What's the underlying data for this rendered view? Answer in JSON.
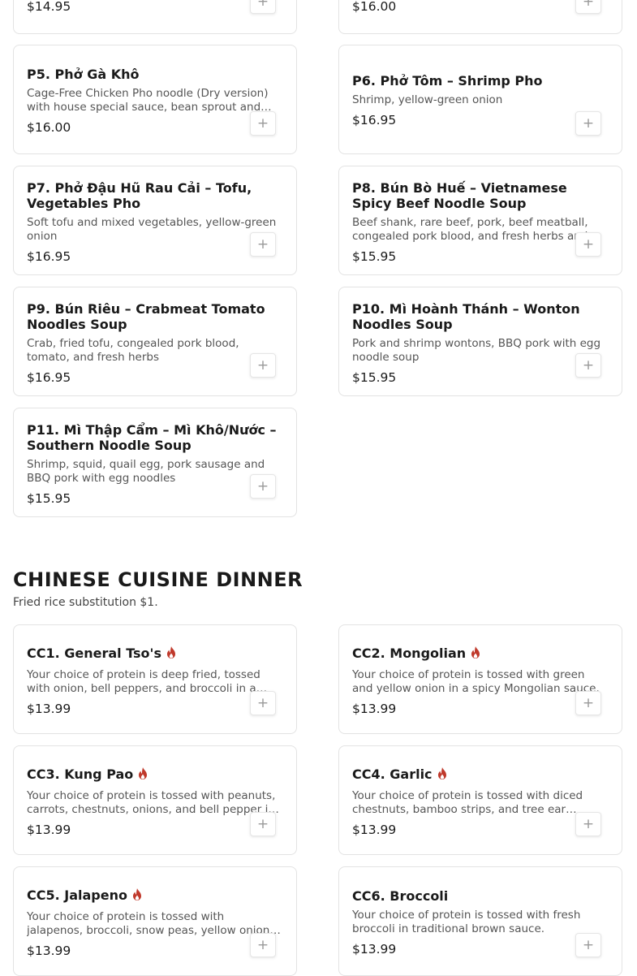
{
  "partial_items": [
    {
      "price": "$14.95"
    },
    {
      "price": "$16.00"
    }
  ],
  "pho_items": [
    {
      "title": "P5. Phở Gà Khô",
      "description": "Cage-Free Chicken Pho noodle (Dry version) with house special sauce, bean sprout and fresh herbs",
      "price": "$16.00"
    },
    {
      "title": "P6. Phở Tôm – Shrimp Pho",
      "description": "Shrimp, yellow-green onion",
      "price": "$16.95"
    },
    {
      "title": "P7. Phở Đậu Hũ Rau Cải – Tofu, Vegetables Pho",
      "description": "Soft tofu and mixed vegetables, yellow-green onion",
      "price": "$16.95"
    },
    {
      "title": "P8. Bún Bò Huế – Vietnamese Spicy Beef Noodle Soup",
      "description": "Beef shank, rare beef, pork, beef meatball, congealed pork blood, and fresh herbs and vegetables",
      "price": "$15.95"
    },
    {
      "title": "P9. Bún Riêu – Crabmeat Tomato Noodles Soup",
      "description": "Crab, fried tofu, congealed pork blood, tomato, and fresh herbs",
      "price": "$16.95"
    },
    {
      "title": "P10. Mì Hoành Thánh – Wonton Noodles Soup",
      "description": "Pork and shrimp wontons, BBQ pork with egg noodle soup",
      "price": "$15.95"
    },
    {
      "title": "P11. Mì Thập Cẩm – Mì Khô/Nước – Southern Noodle Soup",
      "description": "Shrimp, squid, quail egg, pork sausage and BBQ pork with egg noodles",
      "price": "$15.95"
    }
  ],
  "chinese_section": {
    "title": "CHINESE CUISINE DINNER",
    "subtitle": "Fried rice substitution $1."
  },
  "chinese_items": [
    {
      "title": "CC1. General Tso's",
      "description": "Your choice of protein is deep fried, tossed with onion, bell peppers, and broccoli in a sweet and spicy sauce.",
      "price": "$13.99",
      "spicy": true
    },
    {
      "title": "CC2. Mongolian",
      "description": "Your choice of protein is tossed with green and yellow onion in a spicy Mongolian sauce.",
      "price": "$13.99",
      "spicy": true
    },
    {
      "title": "CC3. Kung Pao",
      "description": "Your choice of protein is tossed with peanuts, carrots, chestnuts, onions, and bell pepper in a spicy sauce.",
      "price": "$13.99",
      "spicy": true
    },
    {
      "title": "CC4. Garlic",
      "description": "Your choice of protein is tossed with diced chestnuts, bamboo strips, and tree ear mushrooms in a garlic sauce.",
      "price": "$13.99",
      "spicy": true
    },
    {
      "title": "CC5. Jalapeno",
      "description": "Your choice of protein is tossed with jalapenos, broccoli, snow peas, yellow onions and bell peppers.",
      "price": "$13.99",
      "spicy": true
    },
    {
      "title": "CC6. Broccoli",
      "description": "Your choice of protein is tossed with fresh broccoli in traditional brown sauce.",
      "price": "$13.99",
      "spicy": false
    }
  ],
  "add_button_label": "+",
  "icons": {
    "spicy": "flame-icon",
    "add": "plus-icon"
  },
  "colors": {
    "spicy": "#c0392b",
    "card_border": "#e3e3e3",
    "text": "#1a1a1a",
    "muted": "#555555"
  }
}
